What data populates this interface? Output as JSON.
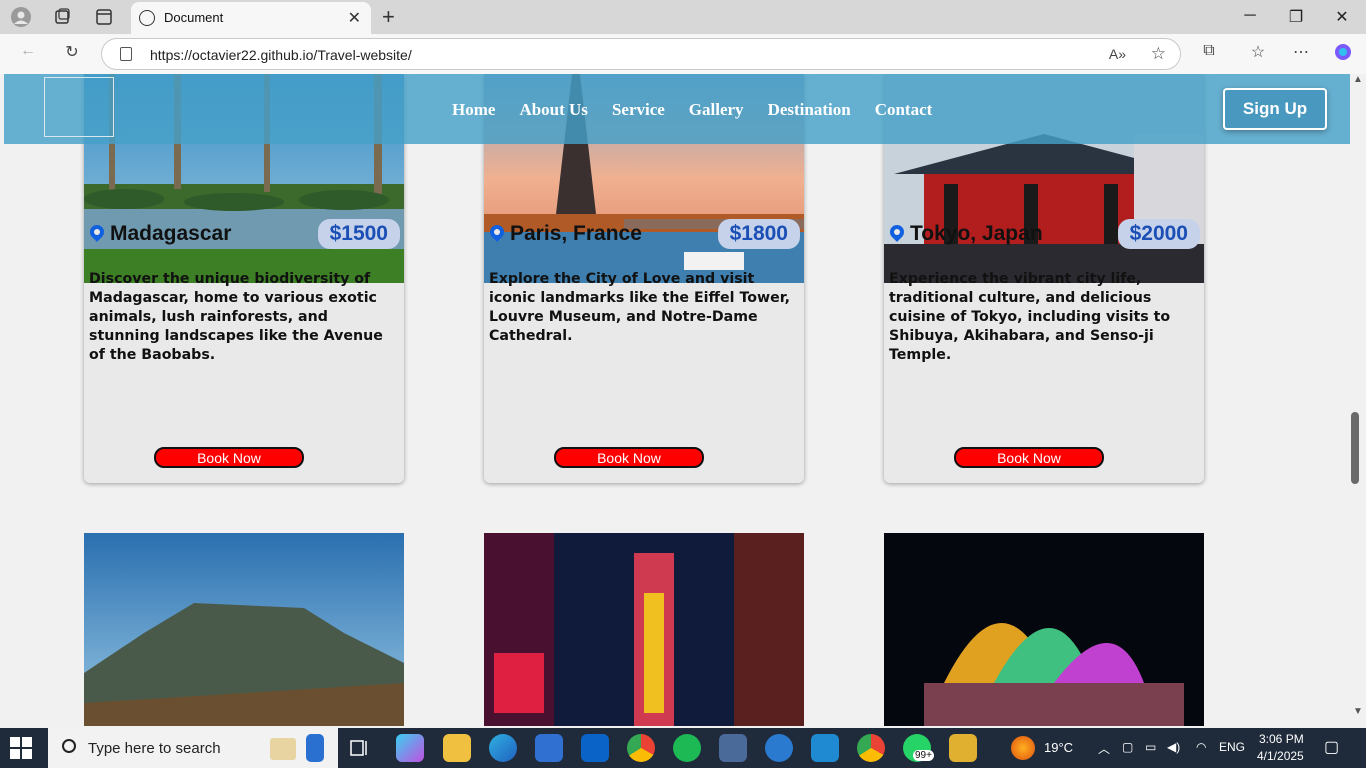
{
  "browser": {
    "tab_title": "Document",
    "url": "https://octavier22.github.io/Travel-website/"
  },
  "nav": {
    "links": [
      "Home",
      "About Us",
      "Service",
      "Gallery",
      "Destination",
      "Contact"
    ],
    "signup": "Sign Up"
  },
  "cards": [
    {
      "place": "Madagascar",
      "price": "$1500",
      "desc": "Discover the unique biodiversity of Madagascar, home to various exotic animals, lush rainforests, and stunning landscapes like the Avenue of the Baobabs.",
      "book": "Book Now"
    },
    {
      "place": "Paris, France",
      "price": "$1800",
      "desc": "Explore the City of Love and visit iconic landmarks like the Eiffel Tower, Louvre Museum, and Notre-Dame Cathedral.",
      "book": "Book Now"
    },
    {
      "place": "Tokyo, Japan",
      "price": "$2000",
      "desc": "Experience the vibrant city life, traditional culture, and delicious cuisine of Tokyo, including visits to Shibuya, Akihabara, and Senso-ji Temple.",
      "book": "Book Now"
    }
  ],
  "taskbar": {
    "search_placeholder": "Type here to search",
    "temperature": "19°C",
    "language": "ENG",
    "time": "3:06 PM",
    "date": "4/1/2025",
    "whatsapp_badge": "99+"
  }
}
